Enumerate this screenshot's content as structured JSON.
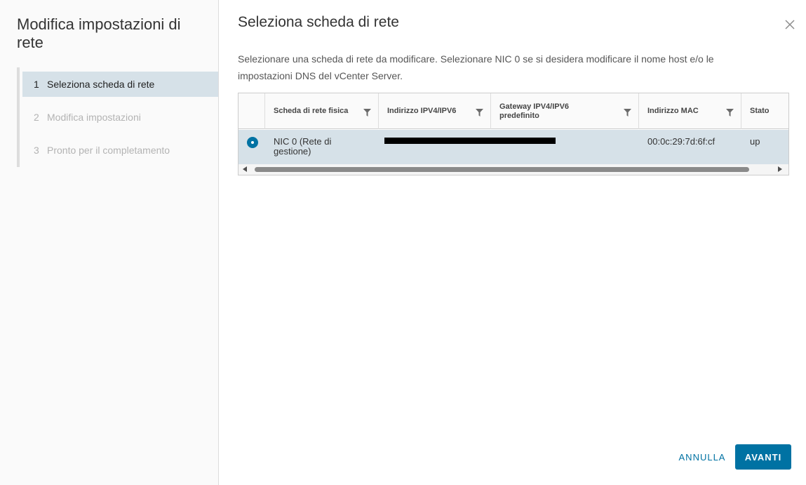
{
  "wizard": {
    "title": "Modifica impostazioni di rete",
    "steps": [
      {
        "number": "1",
        "label": "Seleziona scheda di rete",
        "active": true
      },
      {
        "number": "2",
        "label": "Modifica impostazioni",
        "active": false
      },
      {
        "number": "3",
        "label": "Pronto per il completamento",
        "active": false
      }
    ]
  },
  "page": {
    "title": "Seleziona scheda di rete",
    "description": "Selezionare una scheda di rete da modificare. Selezionare NIC 0 se si desidera modificare il nome host e/o le impostazioni DNS del vCenter Server."
  },
  "grid": {
    "columns": [
      {
        "label": "Scheda di rete fisica",
        "filter_icon": "filter-icon"
      },
      {
        "label": "Indirizzo IPV4/IPV6",
        "filter_icon": "filter-icon"
      },
      {
        "label": "Gateway IPV4/IPV6 predefinito",
        "filter_icon": "filter-icon"
      },
      {
        "label": "Indirizzo MAC",
        "filter_icon": "filter-icon"
      },
      {
        "label": "Stato"
      }
    ],
    "rows": [
      {
        "selected": true,
        "nic": "NIC 0 (Rete di gestione)",
        "ip": "",
        "gateway": "",
        "mac": "00:0c:29:7d:6f:cf",
        "status": "up"
      }
    ]
  },
  "buttons": {
    "cancel": "ANNULLA",
    "next": "AVANTI"
  },
  "colors": {
    "accent": "#0072a3",
    "selected_row": "#d6e1e8"
  }
}
